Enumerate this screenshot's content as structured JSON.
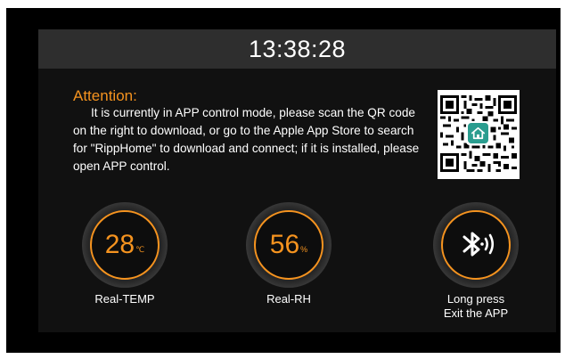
{
  "status_bar": {
    "time": "13:38:28"
  },
  "notice": {
    "title": "Attention:",
    "message": "It is currently in APP control mode, please scan the QR code on the right to download, or go to the Apple App Store to search for \"RippHome\" to download and connect; if it is installed, please open APP control."
  },
  "qr_code": {
    "icon": "qr-code-icon",
    "center_icon": "home-icon"
  },
  "temperature": {
    "value": "28",
    "unit": "℃",
    "label": "Real-TEMP"
  },
  "humidity": {
    "value": "56",
    "unit": "%",
    "label": "Real-RH"
  },
  "exit_app": {
    "icon": "bluetooth-icon",
    "label_line1": "Long press",
    "label_line2": "Exit the APP"
  },
  "colors": {
    "accent": "#f5931f",
    "background": "#111111",
    "status_bar": "#2e2e2e",
    "text": "#ffffff"
  }
}
